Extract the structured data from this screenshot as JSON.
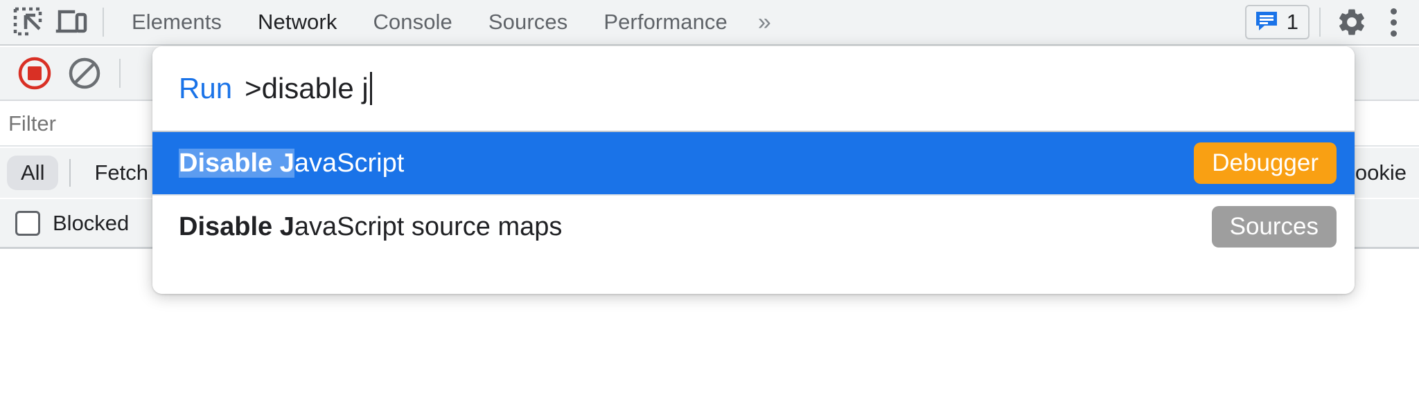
{
  "toolbar": {
    "inspect_icon": "inspect-element-icon",
    "device_icon": "device-toggle-icon",
    "tabs": [
      {
        "label": "Elements",
        "active": false
      },
      {
        "label": "Network",
        "active": true
      },
      {
        "label": "Console",
        "active": false
      },
      {
        "label": "Sources",
        "active": false
      },
      {
        "label": "Performance",
        "active": false
      }
    ],
    "more_tabs_label": "»",
    "message_count": "1",
    "message_icon": "console-message-icon",
    "settings_icon": "gear-icon",
    "menu_icon": "kebab-menu-icon"
  },
  "network": {
    "record_icon": "record-stop-icon",
    "clear_icon": "clear-network-log-icon",
    "filter": {
      "value": "",
      "placeholder": "Filter"
    },
    "types": [
      {
        "label": "All",
        "selected": true
      },
      {
        "label": "Fetch",
        "selected": false
      }
    ],
    "right_cut_label": "ookie",
    "checkbox": {
      "label": "Blocked",
      "checked": false
    }
  },
  "palette": {
    "prefix_label": "Run",
    "query_text": ">disable j",
    "results": [
      {
        "match": "Disable J",
        "rest": "avaScript",
        "tag": "Debugger",
        "tag_color": "#f9a013",
        "selected": true
      },
      {
        "match": "Disable J",
        "rest": "avaScript source maps",
        "tag": "Sources",
        "tag_color": "#9e9e9e",
        "selected": false
      }
    ]
  },
  "colors": {
    "accent_blue": "#1a73e8",
    "toolbar_bg": "#f1f3f4",
    "text_primary": "#202124",
    "text_secondary": "#5f6368",
    "record_red": "#d93025"
  }
}
